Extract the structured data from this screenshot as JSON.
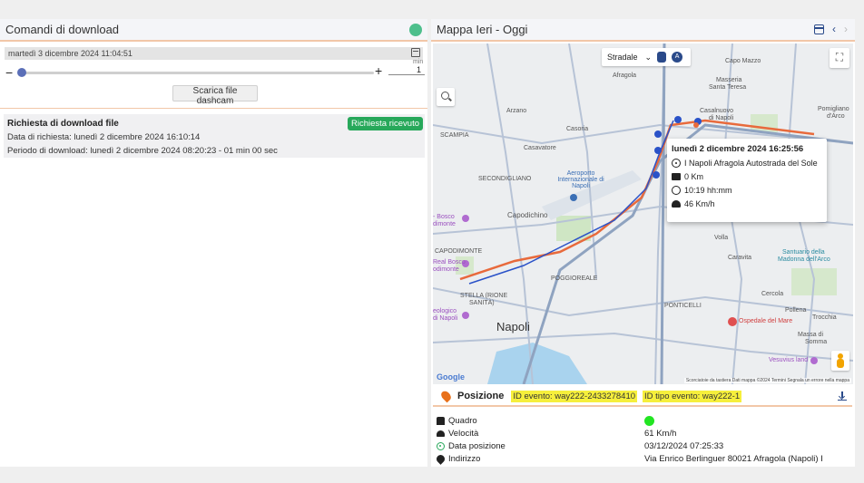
{
  "left": {
    "title": "Comandi di download",
    "status_color": "#4dbf8c",
    "datetime": "martedì 3 dicembre 2024 11:04:51",
    "slider_value": "1",
    "slider_unit": "min",
    "download_button": "Scarica file dashcam",
    "request": {
      "title": "Richiesta di download file",
      "date_line": "Data di richiesta: lunedì 2 dicembre 2024 16:10:14",
      "period_line": "Periodo di download:  lunedì 2 dicembre 2024 08:20:23  -  01 min 00 sec",
      "status_badge": "Richiesta ricevuto"
    }
  },
  "right": {
    "title": "Mappa  Ieri - Oggi",
    "map": {
      "map_type": "Stradale",
      "places": {
        "capo_mazzo": "Capo Mazzo",
        "masseria": "Masseria",
        "santa_teresa": "Santa Teresa",
        "afragola": "Afragola",
        "casalnuovo": "Casalnuovo",
        "di_napoli": "di Napoli",
        "pomigliano": "Pomigliano",
        "darco": "d'Arco",
        "arzano": "Arzano",
        "casoria": "Casoria",
        "scampia": "SCAMPIA",
        "casavatore": "Casavatore",
        "secondigliano": "SECONDIGLIANO",
        "aeroporto": "Aeroporto Internazionale di Napoli",
        "capodichino": "Capodichino",
        "bosco": "- Bosco",
        "dimonte": "dimonte",
        "capodimonte": "CAPODIMONTE",
        "real_bosco": "Real Bosco",
        "dimonte2": "odimonte",
        "volla": "Volla",
        "caravita": "Caravita",
        "santuario": "Santuario della",
        "madonna": "Madonna dell'Arco",
        "stella": "STELLA (RIONE",
        "sanita": "SANITÀ)",
        "poggioreale": "POGGIOREALE",
        "archeologico": "eologico",
        "di_napoli2": "di Napoli",
        "ponticelli": "PONTICELLI",
        "cercola": "Cercola",
        "pollena": "Pollena",
        "trocchia": "Trocchia",
        "napoli": "Napoli",
        "ospedale": "Ospedale del Mare",
        "massa": "Massa di",
        "somma": "Somma",
        "vesuvius": "Vesuvius land",
        "google": "Google",
        "footer": "Scorciatoie da tastiera   Dati mappa ©2024   Termini   Segnala un errore nella mappa"
      },
      "popup": {
        "title": "lunedì 2 dicembre 2024 16:25:56",
        "location": "I Napoli Afragola Autostrada del Sole",
        "distance": "0 Km",
        "duration": "10:19 hh:mm",
        "speed": "46 Km/h"
      }
    },
    "position": {
      "title": "Posizione",
      "event_id": "ID evento: way222-2433278410",
      "event_type": "ID tipo evento: way222-1"
    },
    "details": [
      {
        "label": "Quadro",
        "value": "",
        "status_color": "#22e522"
      },
      {
        "label": "Velocità",
        "value": "61 Km/h"
      },
      {
        "label": "Data posizione",
        "value": "03/12/2024 07:25:33"
      },
      {
        "label": "Indirizzo",
        "value": "Via Enrico Berlinguer 80021 Afragola (Napoli) I"
      }
    ]
  }
}
